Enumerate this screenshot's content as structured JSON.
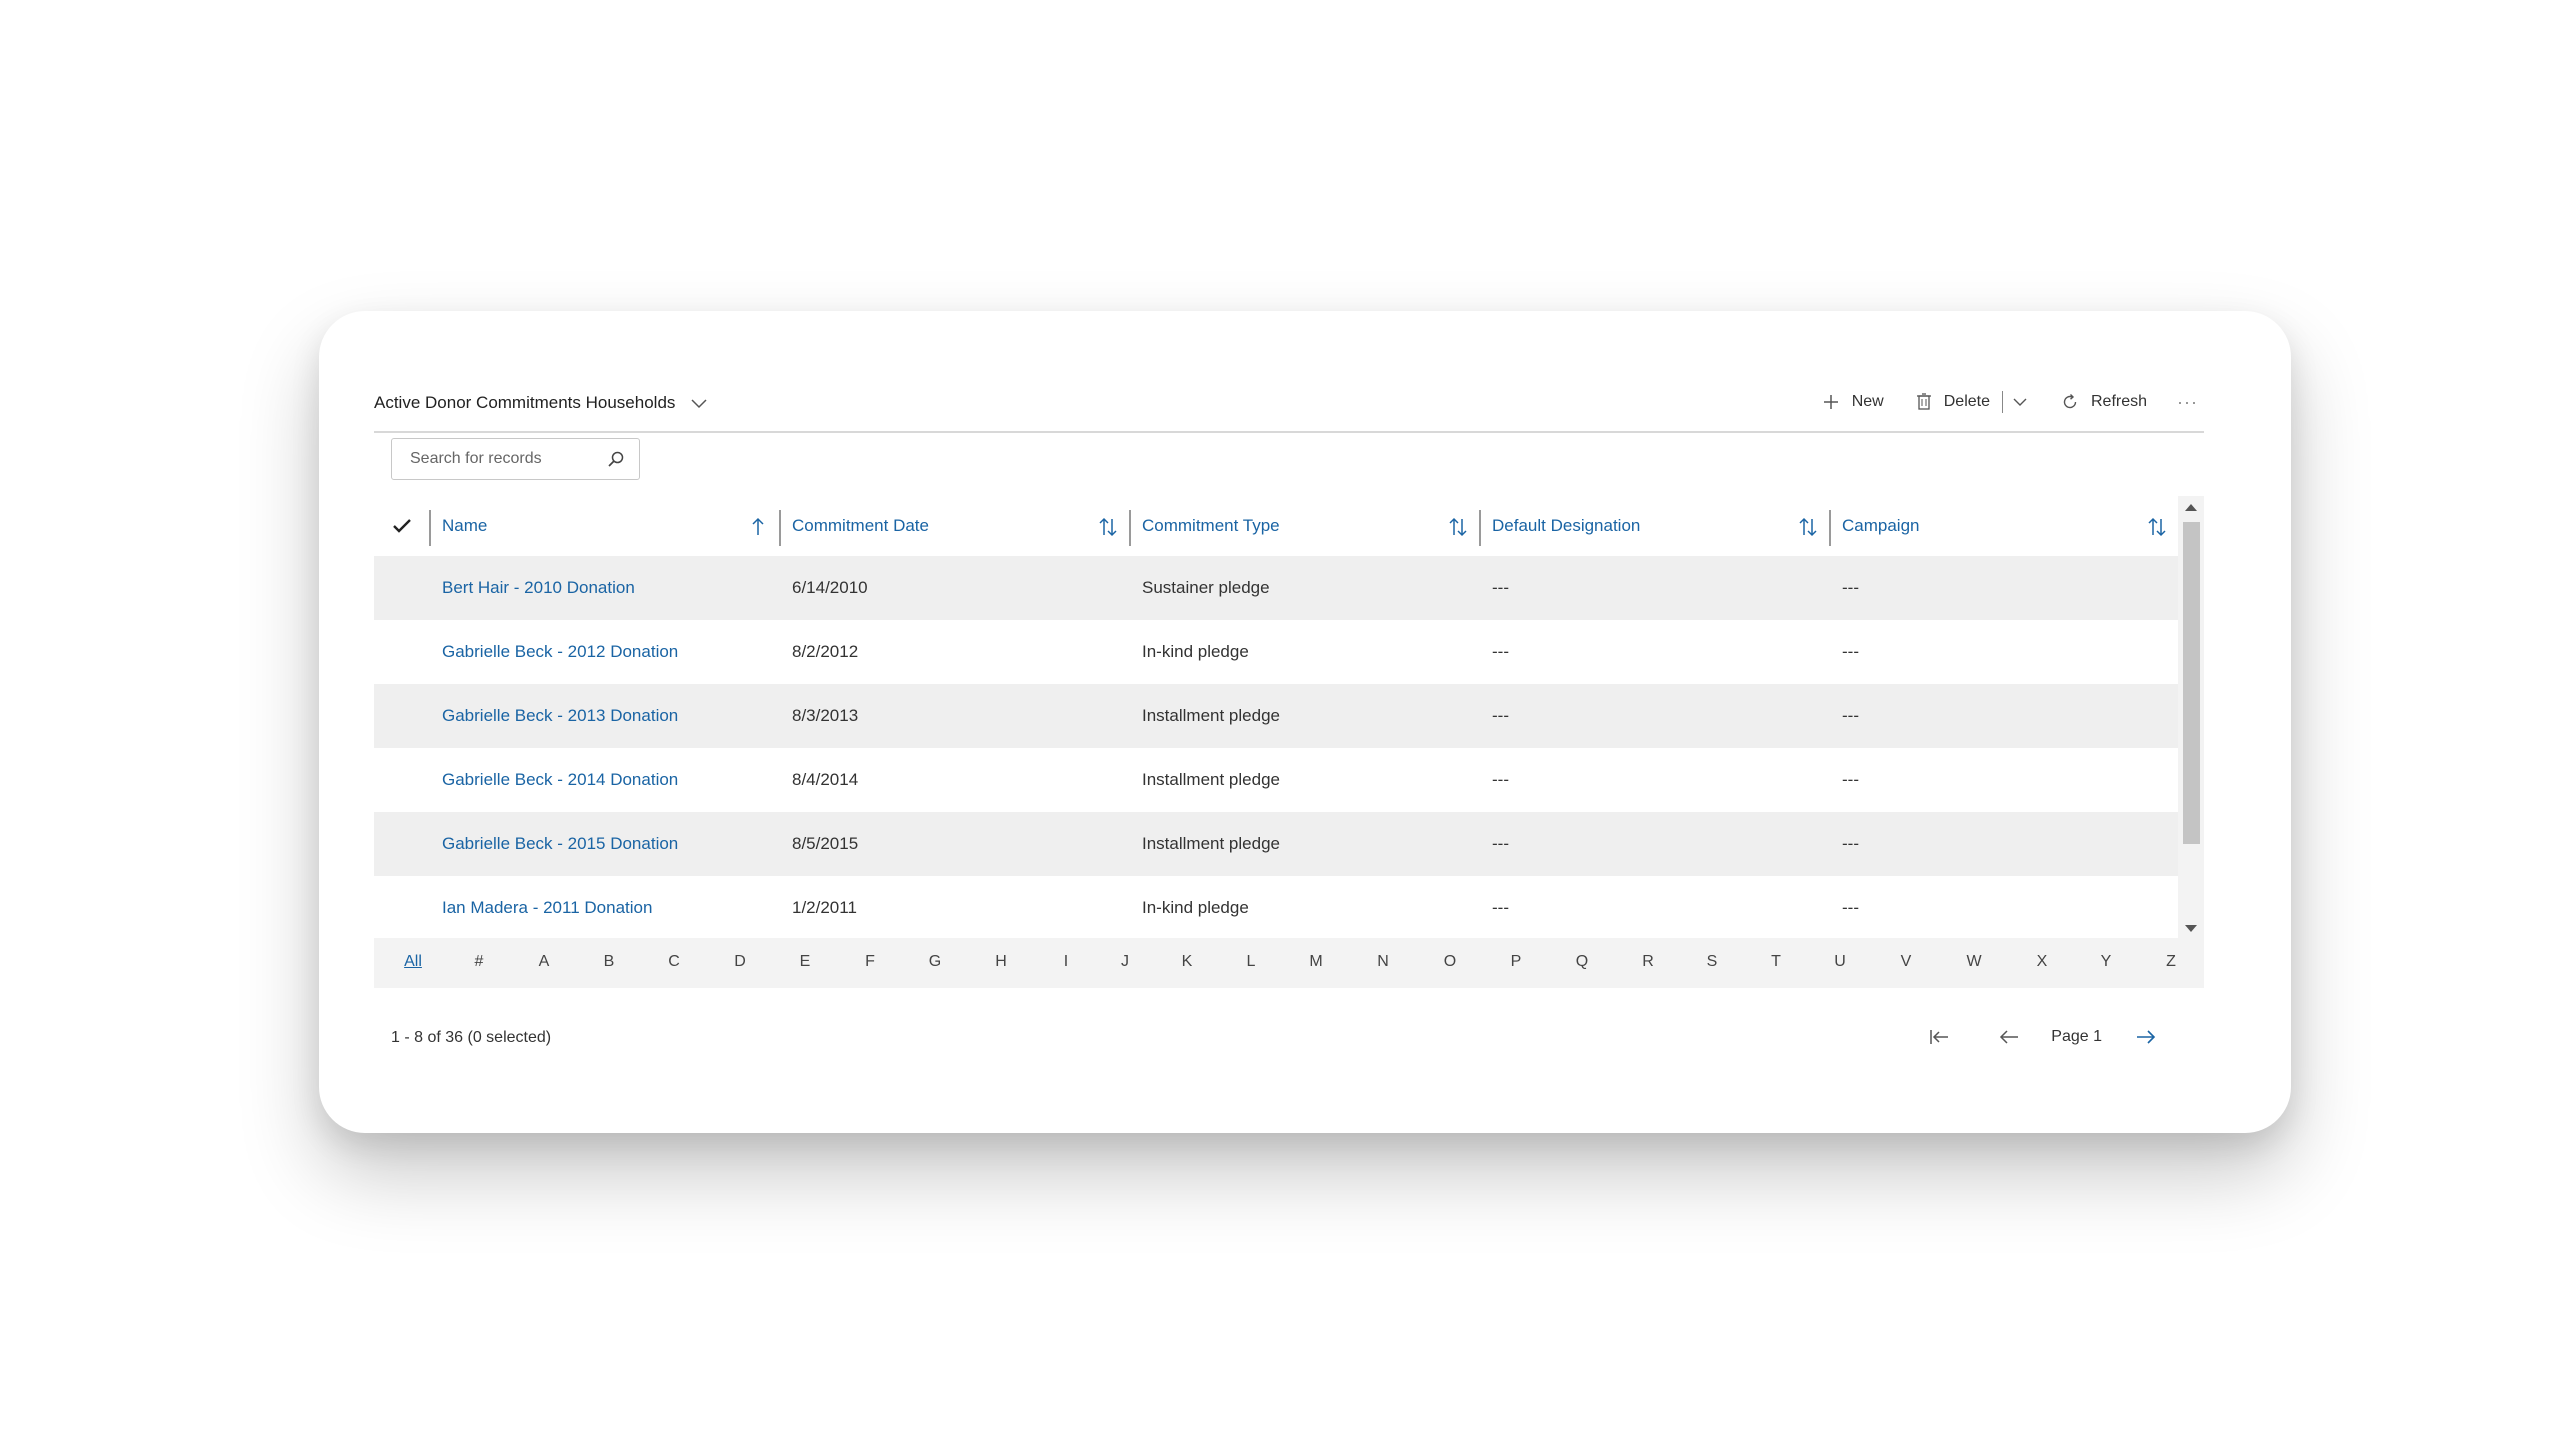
{
  "view": {
    "title": "Active Donor Commitments Households"
  },
  "toolbar": {
    "new_label": "New",
    "delete_label": "Delete",
    "refresh_label": "Refresh",
    "more_label": "···"
  },
  "search": {
    "placeholder": "Search for records"
  },
  "columns": [
    {
      "label": "Name",
      "sort": "ascending"
    },
    {
      "label": "Commitment Date",
      "sort": "none"
    },
    {
      "label": "Commitment Type",
      "sort": "none"
    },
    {
      "label": "Default Designation",
      "sort": "none"
    },
    {
      "label": "Campaign",
      "sort": "none"
    }
  ],
  "rows": [
    {
      "name": "Bert Hair - 2010 Donation",
      "date": "6/14/2010",
      "type": "Sustainer pledge",
      "designation": "---",
      "campaign": "---"
    },
    {
      "name": "Gabrielle Beck - 2012 Donation",
      "date": "8/2/2012",
      "type": "In-kind pledge",
      "designation": "---",
      "campaign": "---"
    },
    {
      "name": "Gabrielle Beck - 2013 Donation",
      "date": "8/3/2013",
      "type": "Installment pledge",
      "designation": "---",
      "campaign": "---"
    },
    {
      "name": "Gabrielle Beck - 2014 Donation",
      "date": "8/4/2014",
      "type": "Installment pledge",
      "designation": "---",
      "campaign": "---"
    },
    {
      "name": "Gabrielle Beck - 2015 Donation",
      "date": "8/5/2015",
      "type": "Installment pledge",
      "designation": "---",
      "campaign": "---"
    },
    {
      "name": "Ian Madera - 2011 Donation",
      "date": "1/2/2011",
      "type": "In-kind pledge",
      "designation": "---",
      "campaign": "---"
    }
  ],
  "alphabet": [
    "All",
    "#",
    "A",
    "B",
    "C",
    "D",
    "E",
    "F",
    "G",
    "H",
    "I",
    "J",
    "K",
    "L",
    "M",
    "N",
    "O",
    "P",
    "Q",
    "R",
    "S",
    "T",
    "U",
    "V",
    "W",
    "X",
    "Y",
    "Z"
  ],
  "alphabet_active": "All",
  "footer": {
    "status": "1 - 8 of 36 (0 selected)",
    "page_label": "Page 1"
  },
  "colors": {
    "link": "#1a64a4",
    "row_alt": "#efefef"
  }
}
